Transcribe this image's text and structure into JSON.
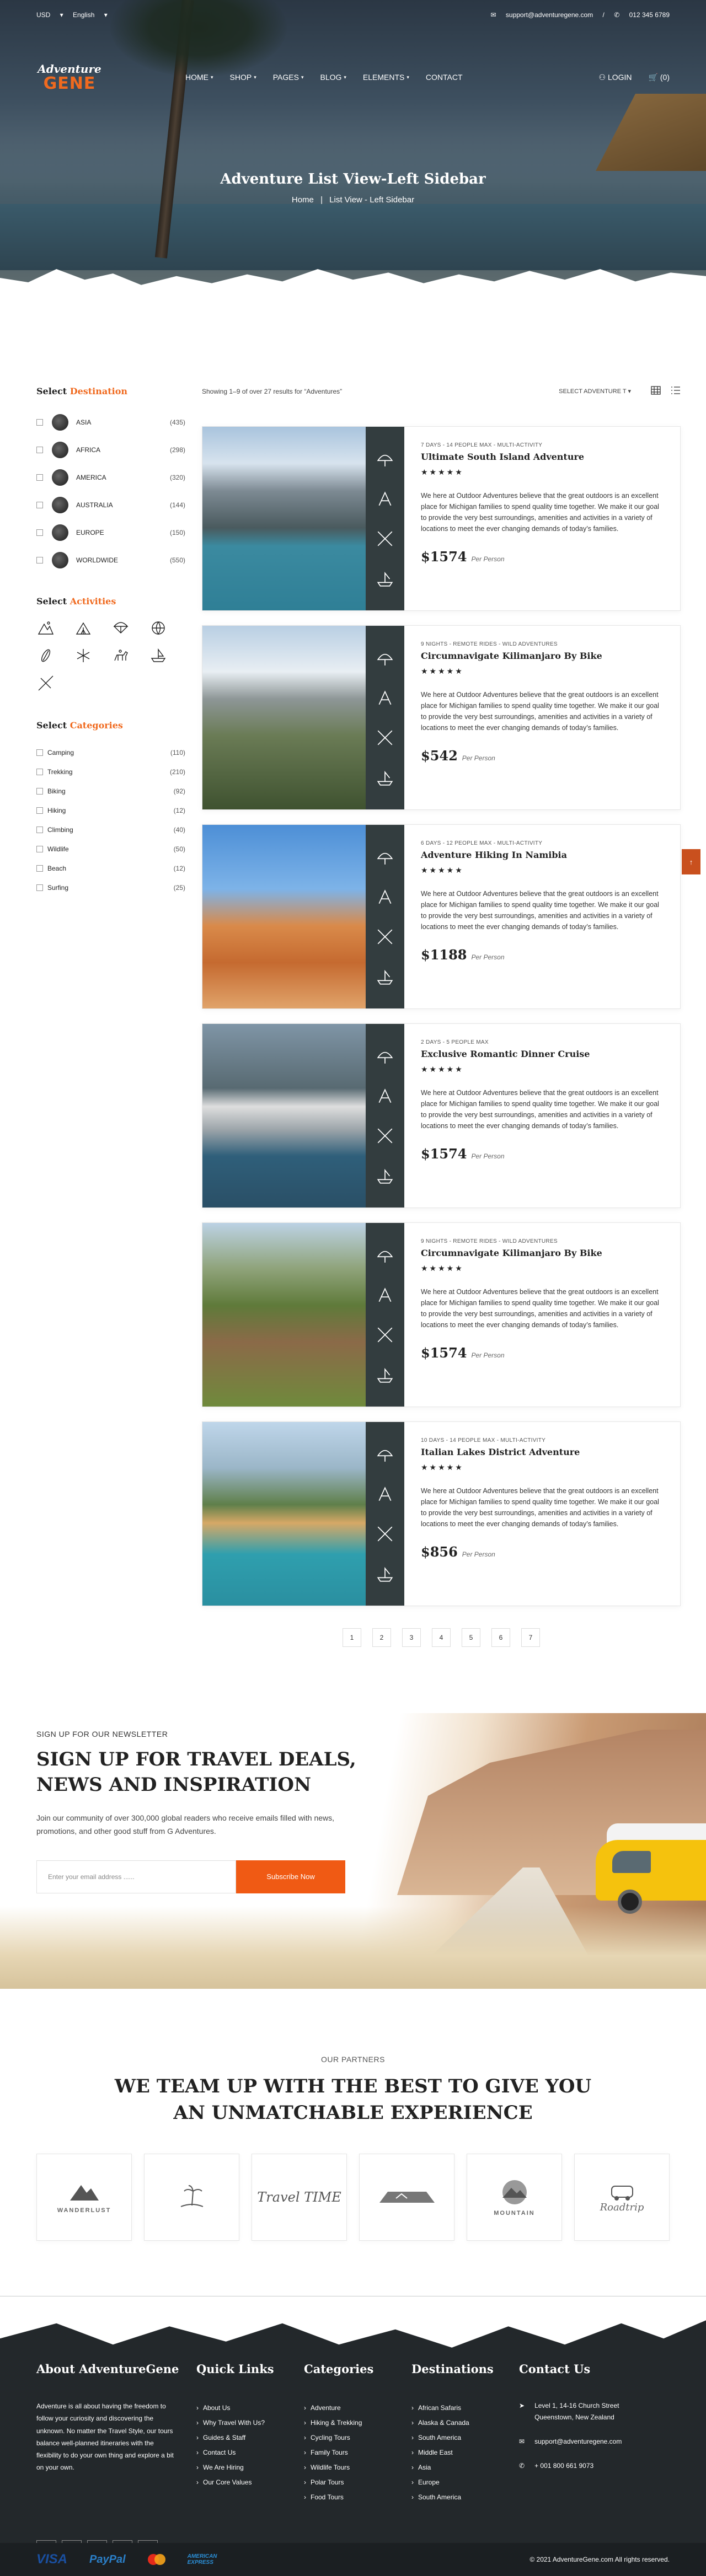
{
  "topbar": {
    "currency": "USD",
    "language": "English",
    "email": "support@adventuregene.com",
    "phone": "012 345 6789"
  },
  "logo": {
    "line1": "Adventure",
    "line2": "GENE"
  },
  "menu": [
    {
      "label": "HOME"
    },
    {
      "label": "SHOP"
    },
    {
      "label": "PAGES"
    },
    {
      "label": "BLOG"
    },
    {
      "label": "ELEMENTS"
    },
    {
      "label": "CONTACT"
    }
  ],
  "nav": {
    "login": "LOGIN",
    "cart": "(0)"
  },
  "hero": {
    "title": "Adventure List View-Left Sidebar",
    "crumb_home": "Home",
    "crumb_sep": "|",
    "crumb_current": "List View - Left Sidebar"
  },
  "sidebar": {
    "dest_title_1": "Select",
    "dest_title_2": "Destination",
    "destinations": [
      {
        "name": "ASIA",
        "count": "(435)"
      },
      {
        "name": "AFRICA",
        "count": "(298)"
      },
      {
        "name": "AMERICA",
        "count": "(320)"
      },
      {
        "name": "AUSTRALIA",
        "count": "(144)"
      },
      {
        "name": "EUROPE",
        "count": "(150)"
      },
      {
        "name": "WORLDWIDE",
        "count": "(550)"
      }
    ],
    "act_title_1": "Select",
    "act_title_2": "Activities",
    "cat_title_1": "Select",
    "cat_title_2": "Categories",
    "categories": [
      {
        "name": "Camping",
        "count": "(110)"
      },
      {
        "name": "Trekking",
        "count": "(210)"
      },
      {
        "name": "Biking",
        "count": "(92)"
      },
      {
        "name": "Hiking",
        "count": "(12)"
      },
      {
        "name": "Climbing",
        "count": "(40)"
      },
      {
        "name": "Wildlife",
        "count": "(50)"
      },
      {
        "name": "Beach",
        "count": "(12)"
      },
      {
        "name": "Surfing",
        "count": "(25)"
      }
    ]
  },
  "toolbar": {
    "showing": "Showing 1–9 of over 27 results for “Adventures”",
    "select": "SELECT ADVENTURE T"
  },
  "common": {
    "description": "We here at Outdoor Adventures believe that the great outdoors is an excellent place for Michigan families to spend quality time together. We make it our goal to provide the very best surroundings, amenities and activities in a variety of locations to meet the ever changing demands of today’s families.",
    "per_person": "Per Person",
    "stars": "★★★★★"
  },
  "cards": [
    {
      "meta": "7 DAYS - 14 PEOPLE MAX - MULTI-ACTIVITY",
      "title": "Ultimate South Island Adventure",
      "price": "$1574"
    },
    {
      "meta": "9 NIGHTS - REMOTE RIDES - WILD ADVENTURES",
      "title": "Circumnavigate Kilimanjaro By Bike",
      "price": "$542"
    },
    {
      "meta": "6 DAYS - 12 PEOPLE MAX - MULTI-ACTIVITY",
      "title": "Adventure Hiking In Namibia",
      "price": "$1188"
    },
    {
      "meta": "2 DAYS - 5 PEOPLE MAX",
      "title": "Exclusive Romantic Dinner Cruise",
      "price": "$1574"
    },
    {
      "meta": "9 NIGHTS - REMOTE RIDES - WILD ADVENTURES",
      "title": "Circumnavigate Kilimanjaro By Bike",
      "price": "$1574"
    },
    {
      "meta": "10 DAYS - 14 PEOPLE MAX - MULTI-ACTIVITY",
      "title": "Italian Lakes District Adventure",
      "price": "$856"
    }
  ],
  "pages": [
    "1",
    "2",
    "3",
    "4",
    "5",
    "6",
    "7"
  ],
  "newsletter": {
    "kicker": "SIGN UP FOR OUR NEWSLETTER",
    "title": "SIGN UP FOR TRAVEL DEALS, NEWS AND INSPIRATION",
    "text": "Join our community of over 300,000 global readers who receive emails filled with news, promotions, and other good stuff from G Adventures.",
    "placeholder": "Enter your email address ......",
    "button": "Subscribe Now"
  },
  "partners": {
    "kicker": "OUR PARTNERS",
    "title": "WE TEAM UP WITH THE BEST TO GIVE YOU AN UNMATCHABLE EXPERIENCE",
    "logos": [
      "WANDERLUST",
      "",
      "Travel TIME",
      "",
      "MOUNTAIN",
      "Roadtrip"
    ]
  },
  "footer": {
    "about_title": "About AdventureGene",
    "about_text": "Adventure is all about having the freedom to follow your curiosity and discovering the unknown. No matter the Travel Style, our tours balance well-planned itineraries with the flexibility to do your own thing and explore a bit on your own.",
    "links_title": "Quick Links",
    "links": [
      "About Us",
      "Why Travel With Us?",
      "Guides & Staff",
      "Contact Us",
      "We Are Hiring",
      "Our Core Values"
    ],
    "cats_title": "Categories",
    "cats": [
      "Adventure",
      "Hiking & Trekking",
      "Cycling Tours",
      "Family Tours",
      "Wildlife Tours",
      "Polar Tours",
      "Food Tours"
    ],
    "dest_title": "Destinations",
    "dests": [
      "African Safaris",
      "Alaska & Canada",
      "South America",
      "Middle East",
      "Asia",
      "Europe",
      "South America"
    ],
    "contact_title": "Contact Us",
    "address": "Level 1, 14-16 Church Street Queenstown, New Zealand",
    "email": "support@adventuregene.com",
    "phone": "+ 001 800 661 9073",
    "copyright": "© 2021 AdventureGene.com All rights reserved.",
    "pay": [
      "VISA",
      "PayPal",
      "AMERICAN EXPRESS"
    ]
  }
}
